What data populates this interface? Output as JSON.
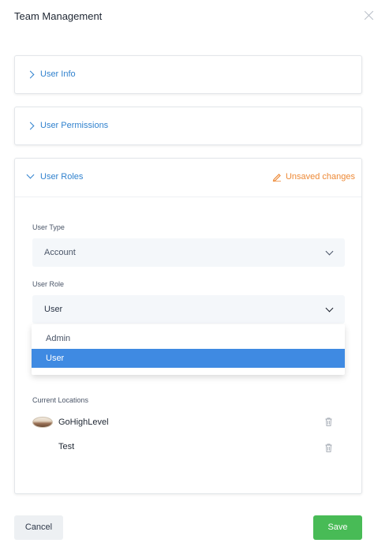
{
  "modal": {
    "title": "Team Management"
  },
  "sections": {
    "user_info": {
      "label": "User Info"
    },
    "user_permissions": {
      "label": "User Permissions"
    },
    "user_roles": {
      "label": "User Roles",
      "status": "Unsaved changes"
    }
  },
  "user_type": {
    "label": "User Type",
    "value": "Account"
  },
  "user_role": {
    "label": "User Role",
    "value": "User",
    "options": [
      "Admin",
      "User"
    ],
    "selected": "User"
  },
  "locations": {
    "label": "Current Locations",
    "items": [
      {
        "name": "GoHighLevel"
      },
      {
        "name": "Test"
      }
    ]
  },
  "footer": {
    "cancel_label": "Cancel",
    "save_label": "Save"
  },
  "colors": {
    "accent": "#3182ce",
    "warning": "#ed8936",
    "save": "#48bb56",
    "selected": "#3f8ae2"
  },
  "icons": [
    "close-icon",
    "chevron-right-icon",
    "chevron-down-icon",
    "pencil-icon",
    "trash-icon"
  ]
}
